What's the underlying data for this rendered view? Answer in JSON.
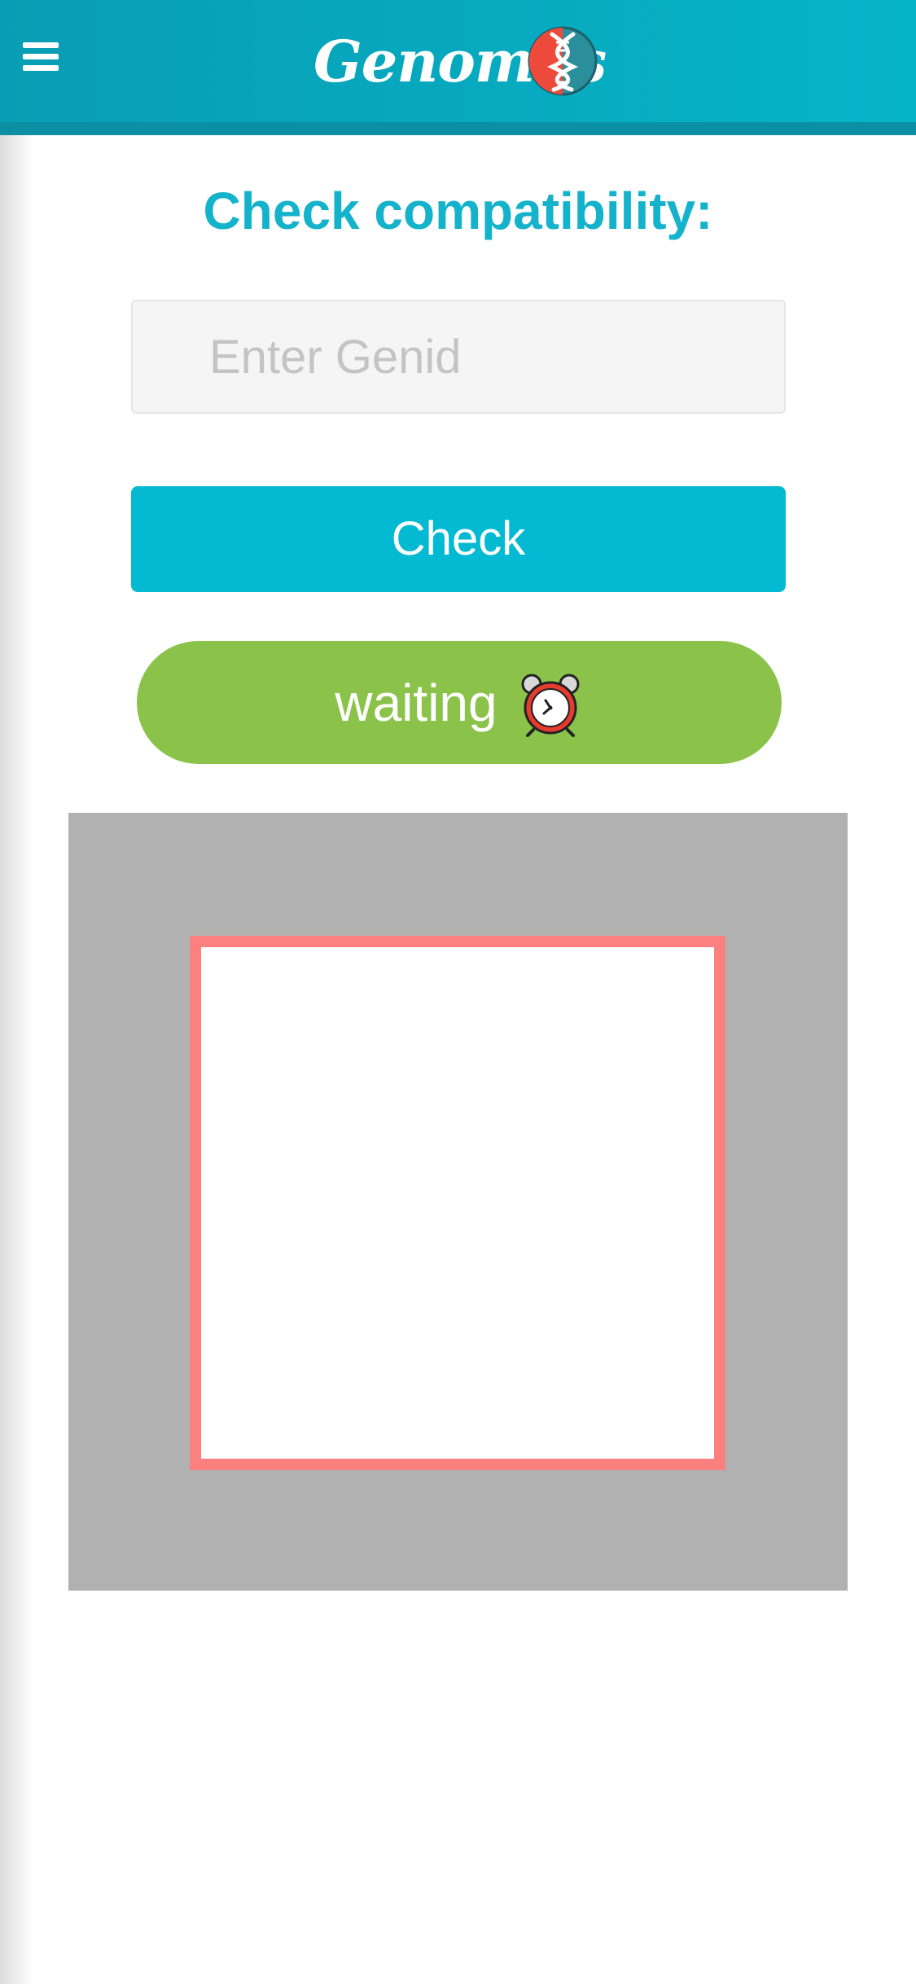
{
  "app": {
    "brand_name": "Genomus",
    "accent_color": "#04bad3",
    "header_color": "#089db4"
  },
  "header": {
    "menu_icon": "hamburger-menu-icon",
    "logo_icon": "dna-logo-icon"
  },
  "main": {
    "title": "Check compatibility:",
    "genid_input": {
      "value": "",
      "placeholder": "Enter Genid"
    },
    "check_button_label": "Check",
    "status": {
      "label": "waiting",
      "icon": "alarm-clock-icon",
      "color": "#8bc34a"
    },
    "scanner": {
      "frame_color": "#fd8080",
      "background_color": "#b1b1b1"
    }
  }
}
